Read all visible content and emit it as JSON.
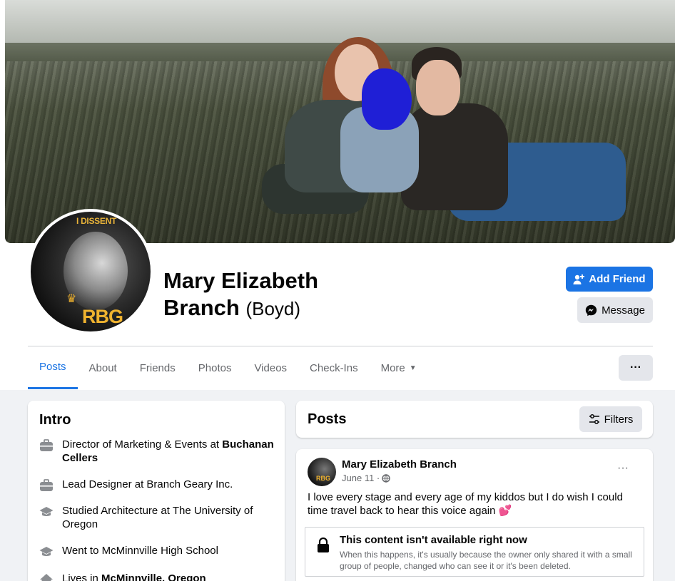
{
  "profile": {
    "name_line1": "Mary Elizabeth",
    "name_line2": "Branch",
    "alternate_name": "(Boyd)",
    "avatar_text_top": "I DISSENT",
    "avatar_text_bottom": "RBG"
  },
  "actions": {
    "add_friend": "Add Friend",
    "message": "Message",
    "more": "···"
  },
  "tabs": [
    {
      "label": "Posts",
      "active": true
    },
    {
      "label": "About"
    },
    {
      "label": "Friends"
    },
    {
      "label": "Photos"
    },
    {
      "label": "Videos"
    },
    {
      "label": "Check-Ins"
    },
    {
      "label": "More"
    }
  ],
  "intro": {
    "title": "Intro",
    "items": [
      {
        "icon": "briefcase-icon",
        "text": "Director of Marketing & Events at ",
        "bold": "Buchanan Cellers"
      },
      {
        "icon": "briefcase-icon",
        "text": "Lead Designer at Branch Geary Inc.",
        "bold": ""
      },
      {
        "icon": "graduation-cap-icon",
        "text": "Studied Architecture at The University of Oregon",
        "bold": ""
      },
      {
        "icon": "graduation-cap-icon",
        "text": "Went to McMinnville High School",
        "bold": ""
      },
      {
        "icon": "home-icon",
        "text": "Lives in ",
        "bold": "McMinnville, Oregon"
      }
    ]
  },
  "posts": {
    "title": "Posts",
    "filters_label": "Filters",
    "items": [
      {
        "author": "Mary Elizabeth Branch",
        "date": "June 11 ·",
        "privacy_icon": "globe-icon",
        "avatar_text": "RBG",
        "text": "I love every stage and every age of my kiddos but I do wish I could time travel back to hear this voice again",
        "emoji": "💕",
        "unavailable_title": "This content isn't available right now",
        "unavailable_body": "When this happens, it's usually because the owner only shared it with a small group of people, changed who can see it or it's been deleted."
      }
    ]
  },
  "colors": {
    "accent": "#1b74e4",
    "page_bg": "#f0f2f5",
    "secondary_button": "#e4e6eb",
    "muted_text": "#65676b"
  }
}
